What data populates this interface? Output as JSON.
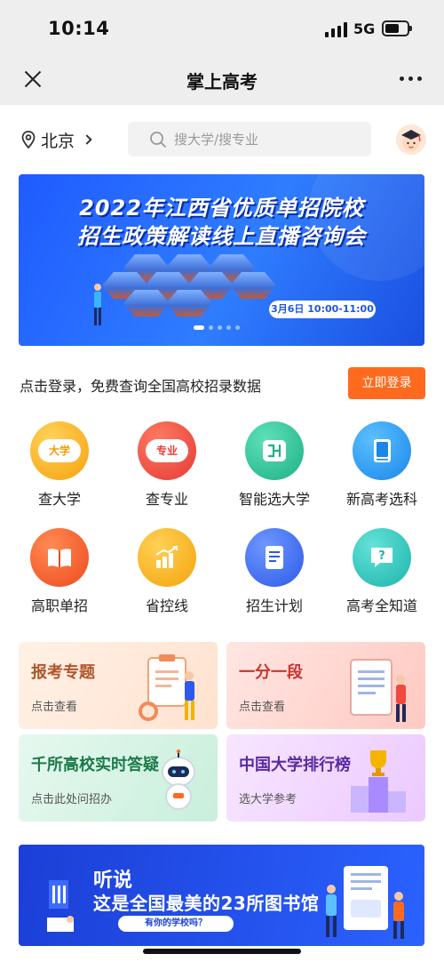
{
  "status_bar": {
    "time": "10:14",
    "network": "5G"
  },
  "nav": {
    "title": "掌上高考"
  },
  "location": {
    "city": "北京"
  },
  "search": {
    "placeholder": "搜大学/搜专业"
  },
  "banner": {
    "line1": "2022年江西省优质单招院校",
    "line2": "招生政策解读线上直播咨询会",
    "date": "3月6日 10:00-11:00",
    "slide_count": 5,
    "active_slide": 1
  },
  "login": {
    "prompt": "点击登录，免费查询全国高校招录数据",
    "button": "立即登录"
  },
  "grid": [
    {
      "label": "查大学",
      "badge": "大学",
      "icon": "university-icon",
      "color": "#ffb21c"
    },
    {
      "label": "查专业",
      "badge": "专业",
      "icon": "major-icon",
      "color": "#f0493f"
    },
    {
      "label": "智能选大学",
      "icon": "smart-pick-icon",
      "color": "#2fc59a"
    },
    {
      "label": "新高考选科",
      "icon": "book-icon",
      "color": "#2e9bf4"
    },
    {
      "label": "高职单招",
      "icon": "open-book-icon",
      "color": "#f4552a"
    },
    {
      "label": "省控线",
      "icon": "bar-chart-icon",
      "color": "#f7ae1c"
    },
    {
      "label": "招生计划",
      "icon": "scroll-icon",
      "color": "#3f6ff2"
    },
    {
      "label": "高考全知道",
      "icon": "question-bubble-icon",
      "color": "#2ec9c0"
    }
  ],
  "cards": [
    {
      "title": "报考专题",
      "subtitle": "点击查看",
      "title_color": "#b0562b"
    },
    {
      "title": "一分一段",
      "subtitle": "点击查看",
      "title_color": "#c7342f"
    },
    {
      "title": "千所高校实时答疑",
      "subtitle": "点击此处问招办",
      "title_color": "#1c7a4a"
    },
    {
      "title": "中国大学排行榜",
      "subtitle": "选大学参考",
      "title_color": "#5a2aa0"
    }
  ],
  "bottom_banner": {
    "line1": "听说",
    "line2": "这是全国最美的23所图书馆",
    "pill": "有你的学校吗？"
  }
}
